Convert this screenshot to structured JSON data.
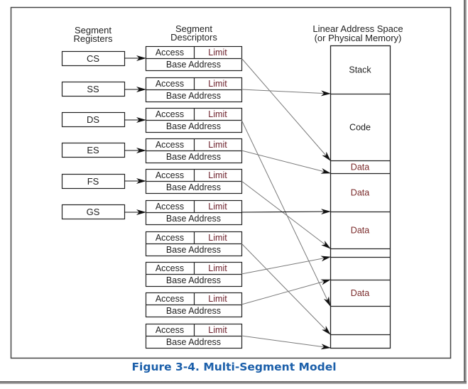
{
  "figure": {
    "caption": "Figure 3-4.  Multi-Segment Model",
    "caption_color": "#1b5faa"
  },
  "headers": {
    "registers_line1": "Segment",
    "registers_line2": "Registers",
    "descriptors_line1": "Segment",
    "descriptors_line2": "Descriptors",
    "memory_line1": "Linear Address Space",
    "memory_line2": "(or Physical Memory)"
  },
  "registers": [
    {
      "label": "CS",
      "descriptor": 0
    },
    {
      "label": "SS",
      "descriptor": 1
    },
    {
      "label": "DS",
      "descriptor": 2
    },
    {
      "label": "ES",
      "descriptor": 3
    },
    {
      "label": "FS",
      "descriptor": 4
    },
    {
      "label": "GS",
      "descriptor": 5
    }
  ],
  "descriptor_fields": {
    "access": "Access",
    "limit": "Limit",
    "base": "Base Address"
  },
  "descriptor_count": 10,
  "memory_segments": [
    {
      "label": "Stack"
    },
    {
      "label": "Code"
    },
    {
      "label": "Data"
    },
    {
      "label": "Data"
    },
    {
      "label": "Data"
    },
    {
      "label": ""
    },
    {
      "label": ""
    },
    {
      "label": "Data"
    },
    {
      "label": ""
    },
    {
      "label": ""
    }
  ],
  "mappings": [
    {
      "descriptor": 0,
      "memory_boundary": 2
    },
    {
      "descriptor": 1,
      "memory_boundary": 1
    },
    {
      "descriptor": 2,
      "memory_boundary": 8
    },
    {
      "descriptor": 3,
      "memory_boundary": 3
    },
    {
      "descriptor": 4,
      "memory_boundary": 5
    },
    {
      "descriptor": 5,
      "memory_boundary": 4
    },
    {
      "descriptor": 6,
      "memory_boundary": 9
    },
    {
      "descriptor": 7,
      "memory_boundary": 6
    },
    {
      "descriptor": 8,
      "memory_boundary": 7
    },
    {
      "descriptor": 9,
      "memory_boundary": 10
    }
  ],
  "colors": {
    "line": "#222222",
    "mapping_line": "#7a7a7a",
    "limit_text": "#6b1f2a",
    "data_text": "#7a2a2a"
  }
}
